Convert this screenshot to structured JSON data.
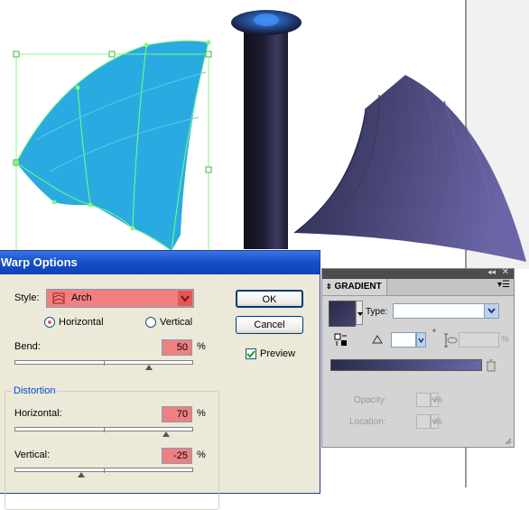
{
  "warp_dialog": {
    "title": "Warp Options",
    "style_label": "Style:",
    "style_value": "Arch",
    "horizontal_option": "Horizontal",
    "vertical_option": "Vertical",
    "orientation_selected": "Horizontal",
    "bend_label": "Bend:",
    "bend_value": "50",
    "bend_fraction": 0.75,
    "percent": "%",
    "distortion_label": "Distortion",
    "dist_horizontal_label": "Horizontal:",
    "dist_horizontal_value": "70",
    "dist_horizontal_fraction": 0.85,
    "dist_vertical_label": "Vertical:",
    "dist_vertical_value": "-25",
    "dist_vertical_fraction": 0.375,
    "ok_label": "OK",
    "cancel_label": "Cancel",
    "preview_label": "Preview",
    "preview_checked": true
  },
  "gradient_panel": {
    "tab_label": "GRADIENT",
    "type_label": "Type:",
    "type_value": "",
    "degree_symbol": "°",
    "percent": "%",
    "opacity_label": "Opacity:",
    "location_label": "Location:",
    "gradient_start_color": "#2a2a4a",
    "gradient_end_color": "#6a66a8"
  },
  "colors": {
    "selection_blue": "#29abe2",
    "selection_outline": "#7cfc7c",
    "dialog_bg": "#ece9d8",
    "field_red": "#f08080",
    "title_blue": "#1750c8"
  }
}
